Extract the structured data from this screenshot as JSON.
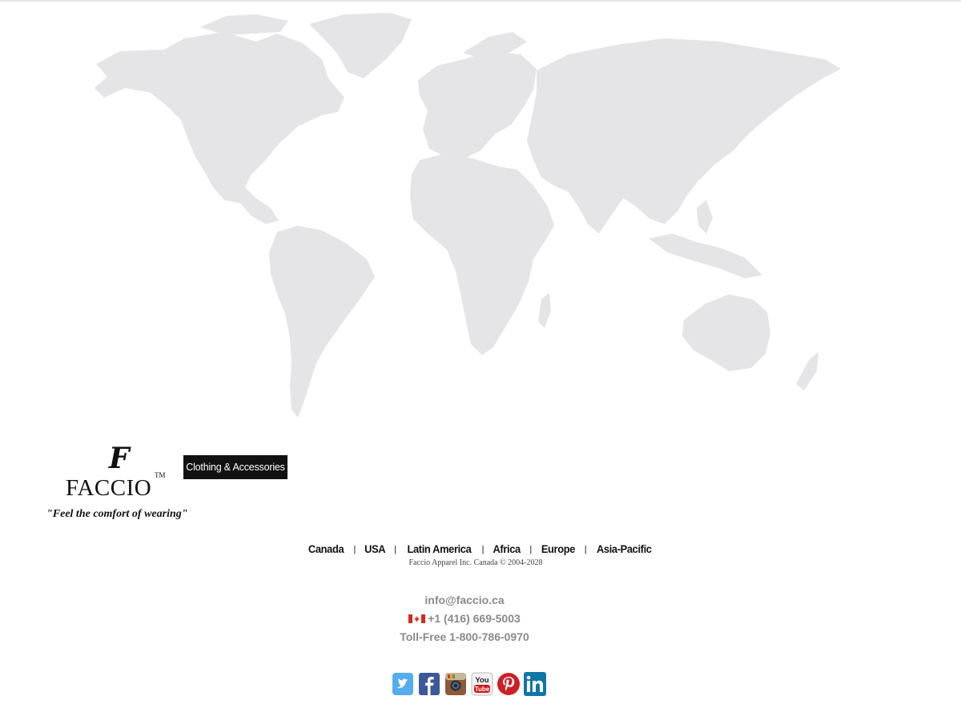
{
  "logo": {
    "emblem": "F",
    "brand": "FACCIO",
    "trademark": "TM",
    "slogan": "\"Feel the comfort of wearing\""
  },
  "tagline": "Clothing & Accessories",
  "regions": [
    "Canada",
    "USA",
    "Latin America",
    "Africa",
    "Europe",
    "Asia-Pacific"
  ],
  "copyright": "Faccio Apparel Inc. Canada © 2004-2028",
  "contact": {
    "email": "info@faccio.ca",
    "phone": "+1 (416) 669-5003",
    "toll_free": "Toll-Free 1-800-786-0970"
  },
  "social": [
    {
      "name": "twitter-icon",
      "color": "#55acee",
      "glyph": "t"
    },
    {
      "name": "facebook-icon",
      "color": "#3b5998",
      "glyph": "f"
    },
    {
      "name": "instagram-icon",
      "color": "#8a5a3b",
      "glyph": ""
    },
    {
      "name": "youtube-icon",
      "color": "#cc181e",
      "glyph": "You Tube"
    },
    {
      "name": "pinterest-icon",
      "color": "#cb2027",
      "glyph": "P"
    },
    {
      "name": "linkedin-icon",
      "color": "#0e76a8",
      "glyph": "in"
    }
  ],
  "colors": {
    "map_fill": "#e5e5e7",
    "text_dark": "#111111",
    "text_gray": "#8a8a8a"
  }
}
